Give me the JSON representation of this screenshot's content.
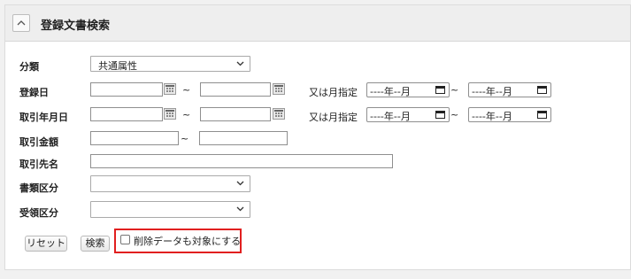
{
  "panel": {
    "title": "登録文書検索"
  },
  "fields": {
    "bunrui": {
      "label": "分類",
      "value": "共通属性"
    },
    "touroku_bi": {
      "label": "登録日",
      "tilde": "~",
      "or_month": "又は月指定",
      "month_from": "----年--月",
      "month_to": "----年--月",
      "month_tilde": "~"
    },
    "torihiki_nengappi": {
      "label": "取引年月日",
      "tilde": "~",
      "or_month": "又は月指定",
      "month_from": "----年--月",
      "month_to": "----年--月",
      "month_tilde": "~"
    },
    "torihiki_kingaku": {
      "label": "取引金額",
      "tilde": "~"
    },
    "torihiki_sakimei": {
      "label": "取引先名"
    },
    "shorui_kubun": {
      "label": "書類区分",
      "value": ""
    },
    "juryo_kubun": {
      "label": "受領区分",
      "value": ""
    }
  },
  "actions": {
    "reset_label": "リセット",
    "search_label": "検索",
    "include_deleted_label": "削除データも対象にする"
  }
}
